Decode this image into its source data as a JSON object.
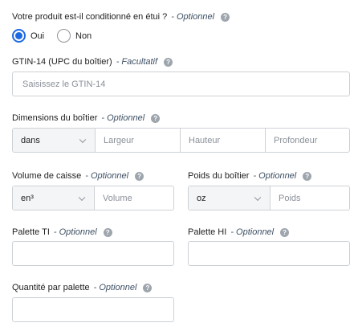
{
  "q_case": {
    "label": "Votre produit est-il conditionné en étui ?",
    "optional": "- Optionnel",
    "help": "?"
  },
  "radios": {
    "yes": "Oui",
    "no": "Non"
  },
  "gtin": {
    "label": "GTIN-14 (UPC du boîtier)",
    "optional": "- Facultatif",
    "help": "?",
    "placeholder": "Saisissez le GTIN-14"
  },
  "dimensions": {
    "label": "Dimensions du boîtier",
    "optional": "- Optionnel",
    "help": "?",
    "unit": "dans",
    "width": "Largeur",
    "height": "Hauteur",
    "depth": "Profondeur"
  },
  "volume": {
    "label": "Volume de caisse",
    "optional": "- Optionnel",
    "help": "?",
    "unit": "en³",
    "placeholder": "Volume"
  },
  "weight": {
    "label": "Poids du boîtier",
    "optional": "- Optionnel",
    "help": "?",
    "unit": "oz",
    "placeholder": "Poids"
  },
  "palette_ti": {
    "label": "Palette TI",
    "optional": "- Optionnel",
    "help": "?"
  },
  "palette_hi": {
    "label": "Palette HI",
    "optional": "- Optionnel",
    "help": "?"
  },
  "qty": {
    "label": "Quantité par palette",
    "optional": "- Optionnel",
    "help": "?"
  }
}
